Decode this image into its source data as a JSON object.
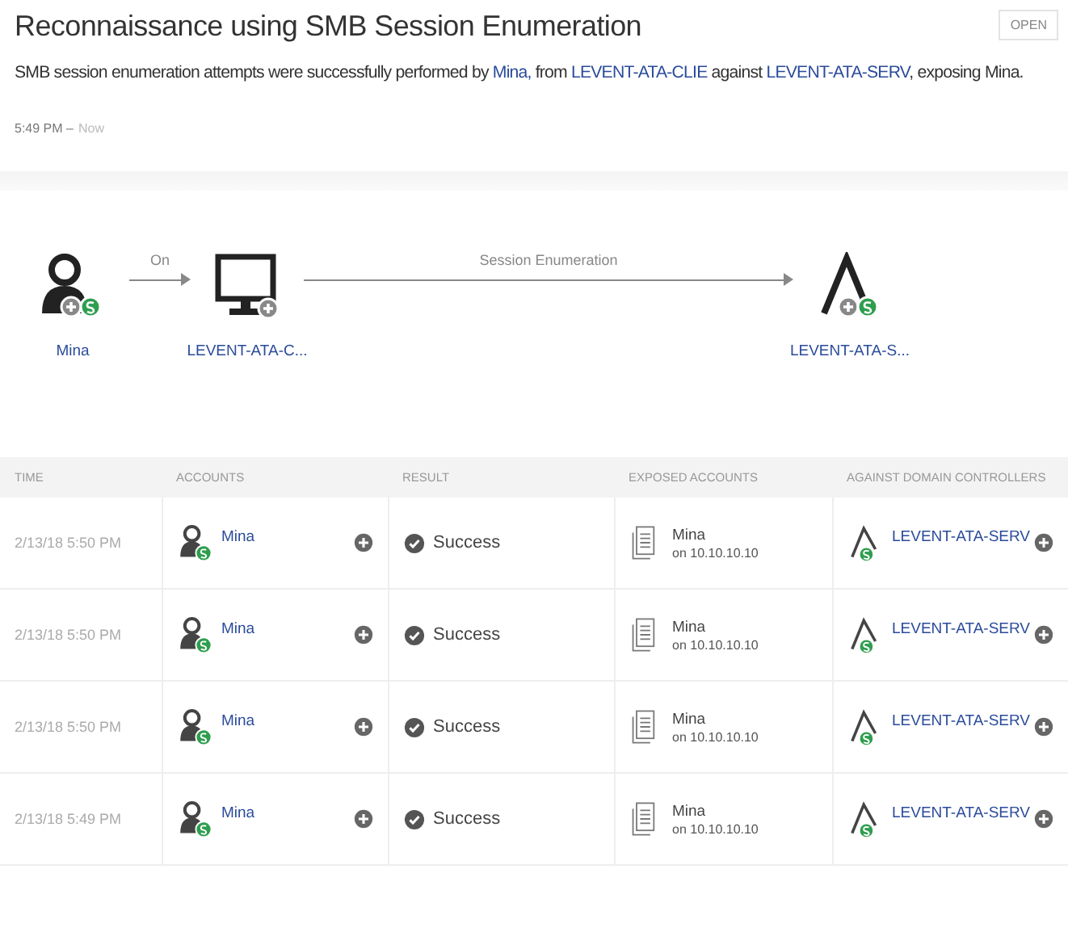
{
  "header": {
    "title": "Reconnaissance using SMB Session Enumeration",
    "open_button": "OPEN"
  },
  "description": [
    {
      "kind": "text",
      "text": "SMB session enumeration attempts were successfully performed by "
    },
    {
      "kind": "link",
      "text": "Mina,"
    },
    {
      "kind": "text",
      "text": " from "
    },
    {
      "kind": "link",
      "text": "LEVENT-ATA-CLIE"
    },
    {
      "kind": "text",
      "text": " against "
    },
    {
      "kind": "link",
      "text": "LEVENT-ATA-SERV"
    },
    {
      "kind": "text",
      "text": ", exposing Mina."
    }
  ],
  "time_range": {
    "start": "5:49 PM –",
    "end": "Now"
  },
  "diagram": {
    "nodes": [
      {
        "kind": "user",
        "label": "Mina"
      },
      {
        "kind": "computer",
        "label": "LEVENT-ATA-C..."
      },
      {
        "kind": "dc",
        "label": "LEVENT-ATA-S..."
      }
    ],
    "edges": [
      {
        "label": "On"
      },
      {
        "label": "Session Enumeration"
      }
    ]
  },
  "table": {
    "columns": [
      "TIME",
      "ACCOUNTS",
      "RESULT",
      "EXPOSED ACCOUNTS",
      "AGAINST DOMAIN CONTROLLERS"
    ],
    "rows": [
      {
        "time": "2/13/18 5:50 PM",
        "account": "Mina",
        "result": "Success",
        "exposed_account": "Mina",
        "exposed_host": "on 10.10.10.10",
        "controller": "LEVENT-ATA-SERV"
      },
      {
        "time": "2/13/18 5:50 PM",
        "account": "Mina",
        "result": "Success",
        "exposed_account": "Mina",
        "exposed_host": "on 10.10.10.10",
        "controller": "LEVENT-ATA-SERV"
      },
      {
        "time": "2/13/18 5:50 PM",
        "account": "Mina",
        "result": "Success",
        "exposed_account": "Mina",
        "exposed_host": "on 10.10.10.10",
        "controller": "LEVENT-ATA-SERV"
      },
      {
        "time": "2/13/18 5:49 PM",
        "account": "Mina",
        "result": "Success",
        "exposed_account": "Mina",
        "exposed_host": "on 10.10.10.10",
        "controller": "LEVENT-ATA-SERV"
      }
    ]
  }
}
